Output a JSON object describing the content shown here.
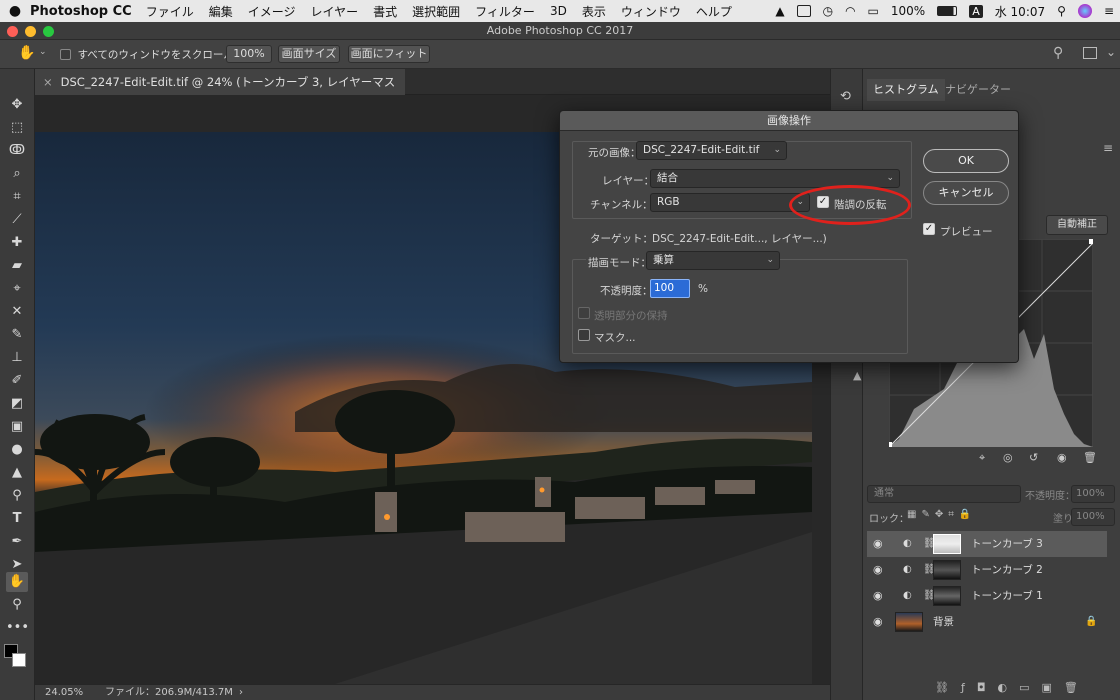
{
  "menubar": {
    "app_name": "Photoshop CC",
    "items": [
      "ファイル",
      "編集",
      "イメージ",
      "レイヤー",
      "書式",
      "選択範囲",
      "フィルター",
      "3D",
      "表示",
      "ウィンドウ",
      "ヘルプ"
    ],
    "battery": "100%",
    "input_mode": "A",
    "clock": "水 10:07"
  },
  "window": {
    "title": "Adobe Photoshop CC 2017"
  },
  "options_bar": {
    "scroll_all_label": "すべてのウィンドウをスクロール",
    "zoom_100": "100%",
    "fit_screen": "画面サイズ",
    "fill_screen": "画面にフィット"
  },
  "document": {
    "tab_title": "DSC_2247-Edit-Edit.tif @ 24% (トーンカーブ 3, レイヤーマスク/16) *",
    "status_zoom": "24.05%",
    "status_file": "ファイル：206.9M/413.7M"
  },
  "panels": {
    "tabs": [
      "ヒストグラム",
      "ナビゲーター"
    ],
    "auto_button": "自動補正",
    "blend_mode": "通常",
    "opacity_label": "不透明度：",
    "opacity_value": "100%",
    "lock_label": "ロック：",
    "fill_label": "塗り：",
    "fill_value": "100%",
    "layers": [
      {
        "name": "トーンカーブ 3",
        "selected": true
      },
      {
        "name": "トーンカーブ 2",
        "selected": false
      },
      {
        "name": "トーンカーブ 1",
        "selected": false
      },
      {
        "name": "背景",
        "selected": false
      }
    ]
  },
  "dialog": {
    "title": "画像操作",
    "source_label": "元の画像：",
    "source_value": "DSC_2247-Edit-Edit.tif",
    "layer_label": "レイヤー：",
    "layer_value": "結合",
    "channel_label": "チャンネル：",
    "channel_value": "RGB",
    "invert_label": "階調の反転",
    "invert_checked": true,
    "target_label": "ターゲット：",
    "target_value": "DSC_2247-Edit-Edit..., レイヤー...)",
    "blend_label": "描画モード：",
    "blend_value": "乗算",
    "opacity_label": "不透明度：",
    "opacity_value": "100",
    "opacity_unit": "%",
    "preserve_label": "透明部分の保持",
    "mask_label": "マスク...",
    "ok": "OK",
    "cancel": "キャンセル",
    "preview_label": "プレビュー",
    "preview_checked": true
  },
  "colors": {
    "highlight_circle": "#e0211c",
    "selection_blue": "#2b6bd6"
  }
}
